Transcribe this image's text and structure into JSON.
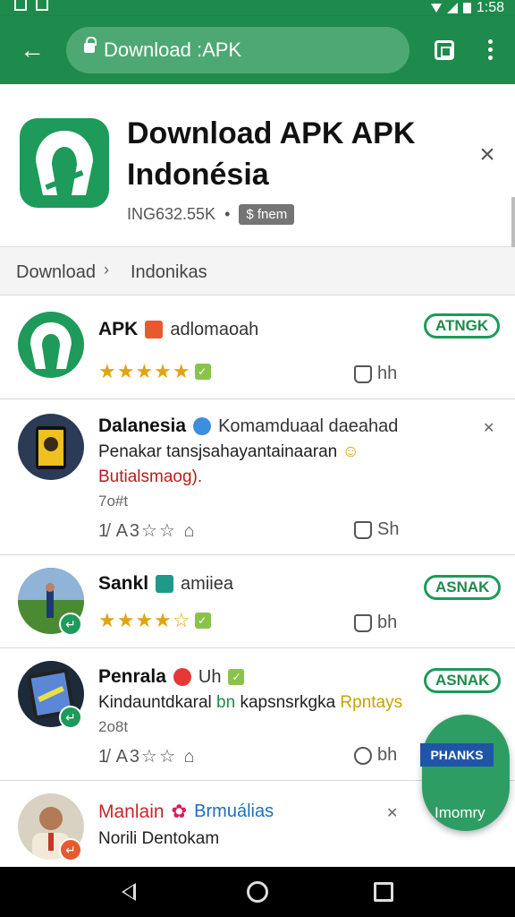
{
  "status_bar": {
    "time": "1:58"
  },
  "toolbar": {
    "url": "Download :APK"
  },
  "header": {
    "title": "Download APK APK Indonésia",
    "meta": "ING632.55K",
    "meta_sep": "•",
    "badge": "$ fnem"
  },
  "breadcrumb": {
    "items": [
      "Download",
      "Indonikas"
    ],
    "separator": "›"
  },
  "list": [
    {
      "title": "APK",
      "subtitle": "adlomaoah",
      "likes": "hh",
      "pill": "ATNGK",
      "stars": "★★★★★"
    },
    {
      "title": "Dalanesia",
      "subtitle": "Komamduaal daeahad",
      "line1": "Penakar tansjsahayantainaaran",
      "line2": "Butialsmaog).",
      "line3": "7o#t",
      "actions": "1̸ A3☆☆ ⌂",
      "likes": "Sh"
    },
    {
      "title": "Sankl",
      "subtitle": "amiiea",
      "likes": "bh",
      "pill": "ASNAK",
      "stars": "★★★★☆"
    },
    {
      "title": "Penrala",
      "subtitle": "Uh",
      "line1": "Kindauntdkaral",
      "line1_accent": "bn",
      "line1_rest": "kapsnsrkgka",
      "line1_tail": "Rpntays",
      "line3": "2o8t",
      "actions": "1̸ A3☆☆ ⌂",
      "likes": "bh",
      "pill": "ASNAK"
    },
    {
      "title": "Manlain",
      "subtitle": "Brmuálias",
      "line1": "Norili Dentokam",
      "pill": "Imomry"
    }
  ],
  "fab": {
    "label": "PHANKS"
  },
  "colors": {
    "brand": "#1e8a4c",
    "accent_blue": "#1f55a8",
    "star": "#e2a312"
  }
}
